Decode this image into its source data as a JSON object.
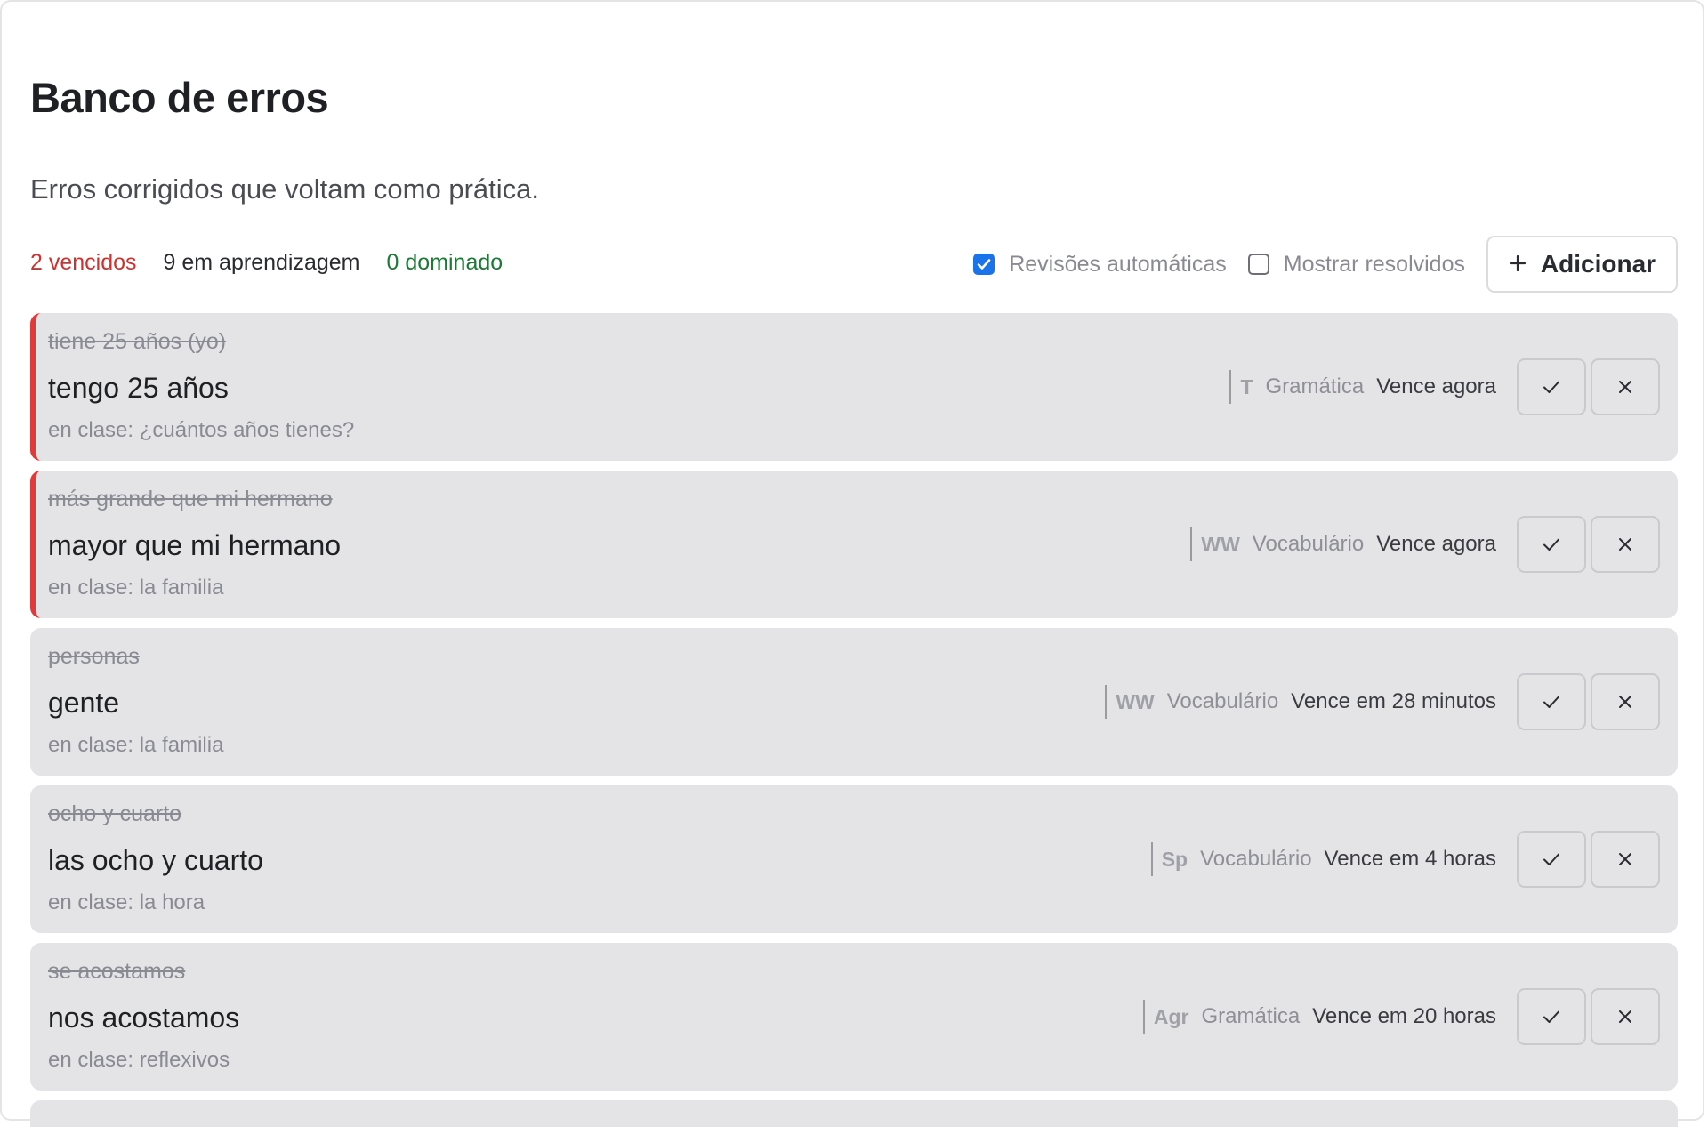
{
  "page": {
    "title": "Banco de erros",
    "subtitle": "Erros corrigidos que voltam como prática."
  },
  "stats": {
    "overdue": "2 vencidos",
    "learning": "9 em aprendizagem",
    "mastered": "0 dominado"
  },
  "controls": {
    "auto_reviews_label": "Revisões automáticas",
    "auto_reviews_checked": true,
    "show_resolved_label": "Mostrar resolvidos",
    "show_resolved_checked": false,
    "add_label": "Adicionar"
  },
  "colors": {
    "overdue": "#d32f2f",
    "mastered": "#1b7a35",
    "checkbox": "#1a73e8",
    "card_bg": "#e4e4e7"
  },
  "icons": {
    "add": "plus-icon",
    "resolve": "check-icon",
    "dismiss": "close-icon"
  },
  "cards": [
    {
      "wrong": "tiene 25 años (yo)",
      "right": "tengo 25 años",
      "context": "en clase: ¿cuántos años tienes?",
      "tag": "T",
      "category": "Gramática",
      "due": "Vence agora",
      "overdue": true
    },
    {
      "wrong": "más grande que mi hermano",
      "right": "mayor que mi hermano",
      "context": "en clase: la familia",
      "tag": "WW",
      "category": "Vocabulário",
      "due": "Vence agora",
      "overdue": true
    },
    {
      "wrong": "personas",
      "right": "gente",
      "context": "en clase: la familia",
      "tag": "WW",
      "category": "Vocabulário",
      "due": "Vence em 28 minutos",
      "overdue": false
    },
    {
      "wrong": "ocho y cuarto",
      "right": "las ocho y cuarto",
      "context": "en clase: la hora",
      "tag": "Sp",
      "category": "Vocabulário",
      "due": "Vence em 4 horas",
      "overdue": false
    },
    {
      "wrong": "se acostamos",
      "right": "nos acostamos",
      "context": "en clase: reflexivos",
      "tag": "Agr",
      "category": "Gramática",
      "due": "Vence em 20 horas",
      "overdue": false
    }
  ]
}
